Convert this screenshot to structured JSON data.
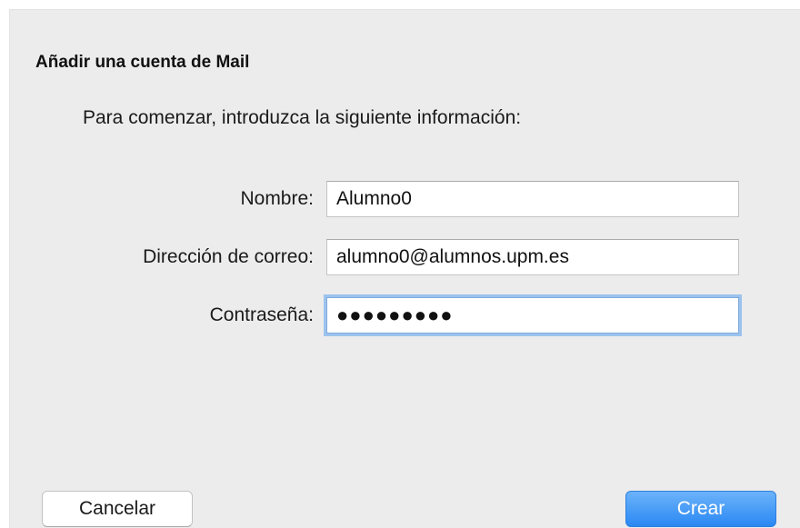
{
  "dialog": {
    "title": "Añadir una cuenta de Mail",
    "intro": "Para comenzar, introduzca la siguiente información:"
  },
  "form": {
    "name": {
      "label": "Nombre:",
      "value": "Alumno0"
    },
    "email": {
      "label": "Dirección de correo:",
      "value": "alumno0@alumnos.upm.es"
    },
    "password": {
      "label": "Contraseña:",
      "masked_value": "●●●●●●●●●"
    }
  },
  "buttons": {
    "cancel_label": "Cancelar",
    "create_label": "Crear"
  },
  "colors": {
    "background": "#ececec",
    "accent": "#2a88f3",
    "focus_ring": "#9cc3ee"
  }
}
